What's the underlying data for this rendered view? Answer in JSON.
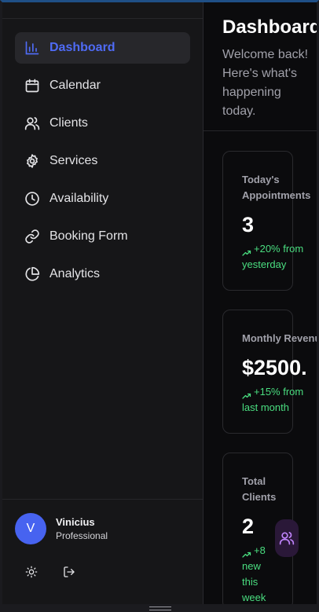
{
  "sidebar": {
    "items": [
      {
        "label": "Dashboard",
        "icon": "bar-chart-icon",
        "active": true
      },
      {
        "label": "Calendar",
        "icon": "calendar-icon",
        "active": false
      },
      {
        "label": "Clients",
        "icon": "users-icon",
        "active": false
      },
      {
        "label": "Services",
        "icon": "gear-icon",
        "active": false
      },
      {
        "label": "Availability",
        "icon": "clock-icon",
        "active": false
      },
      {
        "label": "Booking Form",
        "icon": "link-icon",
        "active": false
      },
      {
        "label": "Analytics",
        "icon": "pie-chart-icon",
        "active": false
      }
    ],
    "user": {
      "initial": "V",
      "name": "Vinicius",
      "role": "Professional"
    },
    "footer": {
      "theme_icon": "sun-icon",
      "logout_icon": "logout-icon"
    }
  },
  "main": {
    "title": "Dashboard",
    "subtitle": "Welcome back! Here's what's happening today.",
    "stats": [
      {
        "label": "Today's Appointments",
        "value": "3",
        "change": "+20% from yesterday"
      },
      {
        "label": "Monthly Revenue",
        "value": "$2500.",
        "change": "+15% from last month"
      },
      {
        "label": "Total Clients",
        "value": "2",
        "change": "+8 new this week",
        "icon": "users-icon"
      }
    ]
  },
  "colors": {
    "accent": "#4f6bf5",
    "positive": "#4ade80",
    "avatar": "#4763f0",
    "clients_icon": "#c084fc"
  }
}
